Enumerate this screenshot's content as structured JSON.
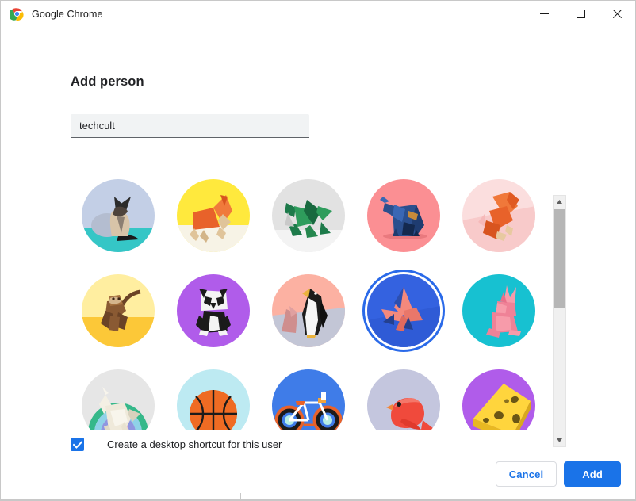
{
  "window": {
    "title": "Google Chrome",
    "app_icon": "chrome-logo-icon",
    "controls": {
      "minimize": "minimize-icon",
      "maximize": "maximize-icon",
      "close": "close-icon"
    }
  },
  "dialog": {
    "heading": "Add person",
    "name_input": {
      "value": "techcult",
      "placeholder": ""
    },
    "checkbox": {
      "label": "Create a desktop shortcut for this user",
      "checked": true
    },
    "buttons": {
      "cancel": "Cancel",
      "add": "Add"
    }
  },
  "avatar_grid": {
    "columns": 5,
    "selected_index": 8,
    "scrollbar": {
      "up_arrow": "scroll-up-icon",
      "down_arrow": "scroll-down-icon"
    },
    "items": [
      {
        "name": "origami-cat",
        "label": "Cat"
      },
      {
        "name": "origami-dog",
        "label": "Dog"
      },
      {
        "name": "origami-dragon",
        "label": "Dragon"
      },
      {
        "name": "origami-elephant",
        "label": "Elephant"
      },
      {
        "name": "origami-fox",
        "label": "Fox"
      },
      {
        "name": "origami-monkey",
        "label": "Monkey"
      },
      {
        "name": "origami-panda",
        "label": "Panda"
      },
      {
        "name": "origami-penguin",
        "label": "Penguin"
      },
      {
        "name": "origami-butterfly",
        "label": "Butterfly"
      },
      {
        "name": "origami-rabbit",
        "label": "Rabbit"
      },
      {
        "name": "origami-unicorn",
        "label": "Unicorn"
      },
      {
        "name": "basketball",
        "label": "Basketball"
      },
      {
        "name": "bicycle",
        "label": "Bicycle"
      },
      {
        "name": "red-bird",
        "label": "Bird"
      },
      {
        "name": "cheese",
        "label": "Cheese"
      }
    ]
  },
  "colors": {
    "accent": "#1a73e8",
    "selected_ring": "#2a6ae9",
    "input_background": "#f1f3f4",
    "text": "#202124",
    "window_border": "#c8c8c8"
  }
}
